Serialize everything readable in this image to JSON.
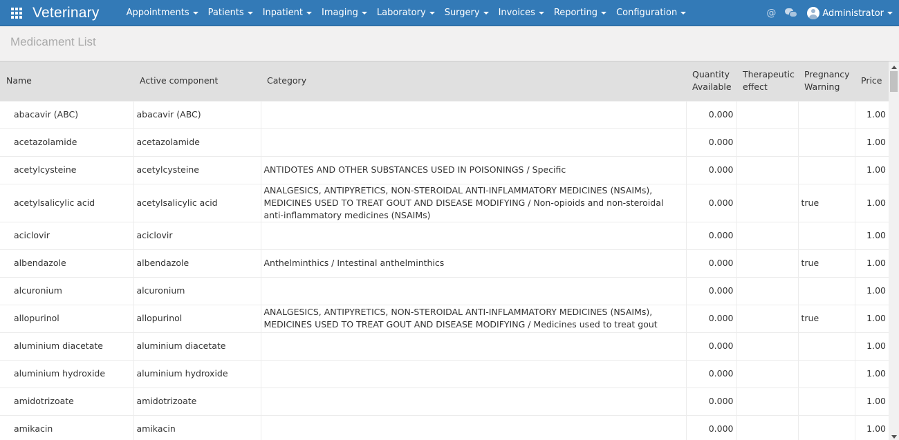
{
  "app": {
    "brand": "Veterinary",
    "menu": [
      {
        "label": "Appointments"
      },
      {
        "label": "Patients"
      },
      {
        "label": "Inpatient"
      },
      {
        "label": "Imaging"
      },
      {
        "label": "Laboratory"
      },
      {
        "label": "Surgery"
      },
      {
        "label": "Invoices"
      },
      {
        "label": "Reporting"
      },
      {
        "label": "Configuration"
      }
    ],
    "user": "Administrator",
    "at_symbol": "@"
  },
  "page": {
    "title": "Medicament List"
  },
  "table": {
    "headers": {
      "name": "Name",
      "active_component": "Active component",
      "category": "Category",
      "quantity_1": "Quantity",
      "quantity_2": "Available",
      "therapeutic_1": "Therapeutic",
      "therapeutic_2": "effect",
      "pregnancy_1": "Pregnancy",
      "pregnancy_2": "Warning",
      "price": "Price"
    },
    "rows": [
      {
        "name": "abacavir (ABC)",
        "active": "abacavir (ABC)",
        "category": "",
        "qty": "0.000",
        "effect": "",
        "pregnancy": "",
        "price": "1.00"
      },
      {
        "name": "acetazolamide",
        "active": "acetazolamide",
        "category": "",
        "qty": "0.000",
        "effect": "",
        "pregnancy": "",
        "price": "1.00"
      },
      {
        "name": "acetylcysteine",
        "active": "acetylcysteine",
        "category": "ANTIDOTES AND OTHER SUBSTANCES USED IN POISONINGS / Specific",
        "qty": "0.000",
        "effect": "",
        "pregnancy": "",
        "price": "1.00"
      },
      {
        "name": "acetylsalicylic acid",
        "active": "acetylsalicylic acid",
        "category": "ANALGESICS, ANTIPYRETICS, NON-STEROIDAL ANTI-INFLAMMATORY MEDICINES (NSAIMs), MEDICINES USED TO TREAT GOUT AND DISEASE MODIFYING / Non-opioids and non-steroidal anti-inflammatory medicines (NSAIMs)",
        "qty": "0.000",
        "effect": "",
        "pregnancy": "true",
        "price": "1.00"
      },
      {
        "name": "aciclovir",
        "active": "aciclovir",
        "category": "",
        "qty": "0.000",
        "effect": "",
        "pregnancy": "",
        "price": "1.00"
      },
      {
        "name": "albendazole",
        "active": "albendazole",
        "category": "Anthelminthics / Intestinal anthelminthics",
        "qty": "0.000",
        "effect": "",
        "pregnancy": "true",
        "price": "1.00"
      },
      {
        "name": "alcuronium",
        "active": "alcuronium",
        "category": "",
        "qty": "0.000",
        "effect": "",
        "pregnancy": "",
        "price": "1.00"
      },
      {
        "name": "allopurinol",
        "active": "allopurinol",
        "category": "ANALGESICS, ANTIPYRETICS, NON-STEROIDAL ANTI-INFLAMMATORY MEDICINES (NSAIMs), MEDICINES USED TO TREAT GOUT AND DISEASE MODIFYING / Medicines used to treat gout",
        "qty": "0.000",
        "effect": "",
        "pregnancy": "true",
        "price": "1.00"
      },
      {
        "name": "aluminium diacetate",
        "active": "aluminium diacetate",
        "category": "",
        "qty": "0.000",
        "effect": "",
        "pregnancy": "",
        "price": "1.00"
      },
      {
        "name": "aluminium hydroxide",
        "active": "aluminium hydroxide",
        "category": "",
        "qty": "0.000",
        "effect": "",
        "pregnancy": "",
        "price": "1.00"
      },
      {
        "name": "amidotrizoate",
        "active": "amidotrizoate",
        "category": "",
        "qty": "0.000",
        "effect": "",
        "pregnancy": "",
        "price": "1.00"
      },
      {
        "name": "amikacin",
        "active": "amikacin",
        "category": "",
        "qty": "0.000",
        "effect": "",
        "pregnancy": "",
        "price": "1.00"
      }
    ]
  },
  "colors": {
    "navbar": "#337ab7",
    "header_bg": "#e0e0e0",
    "title_color": "#aaaaaa"
  }
}
